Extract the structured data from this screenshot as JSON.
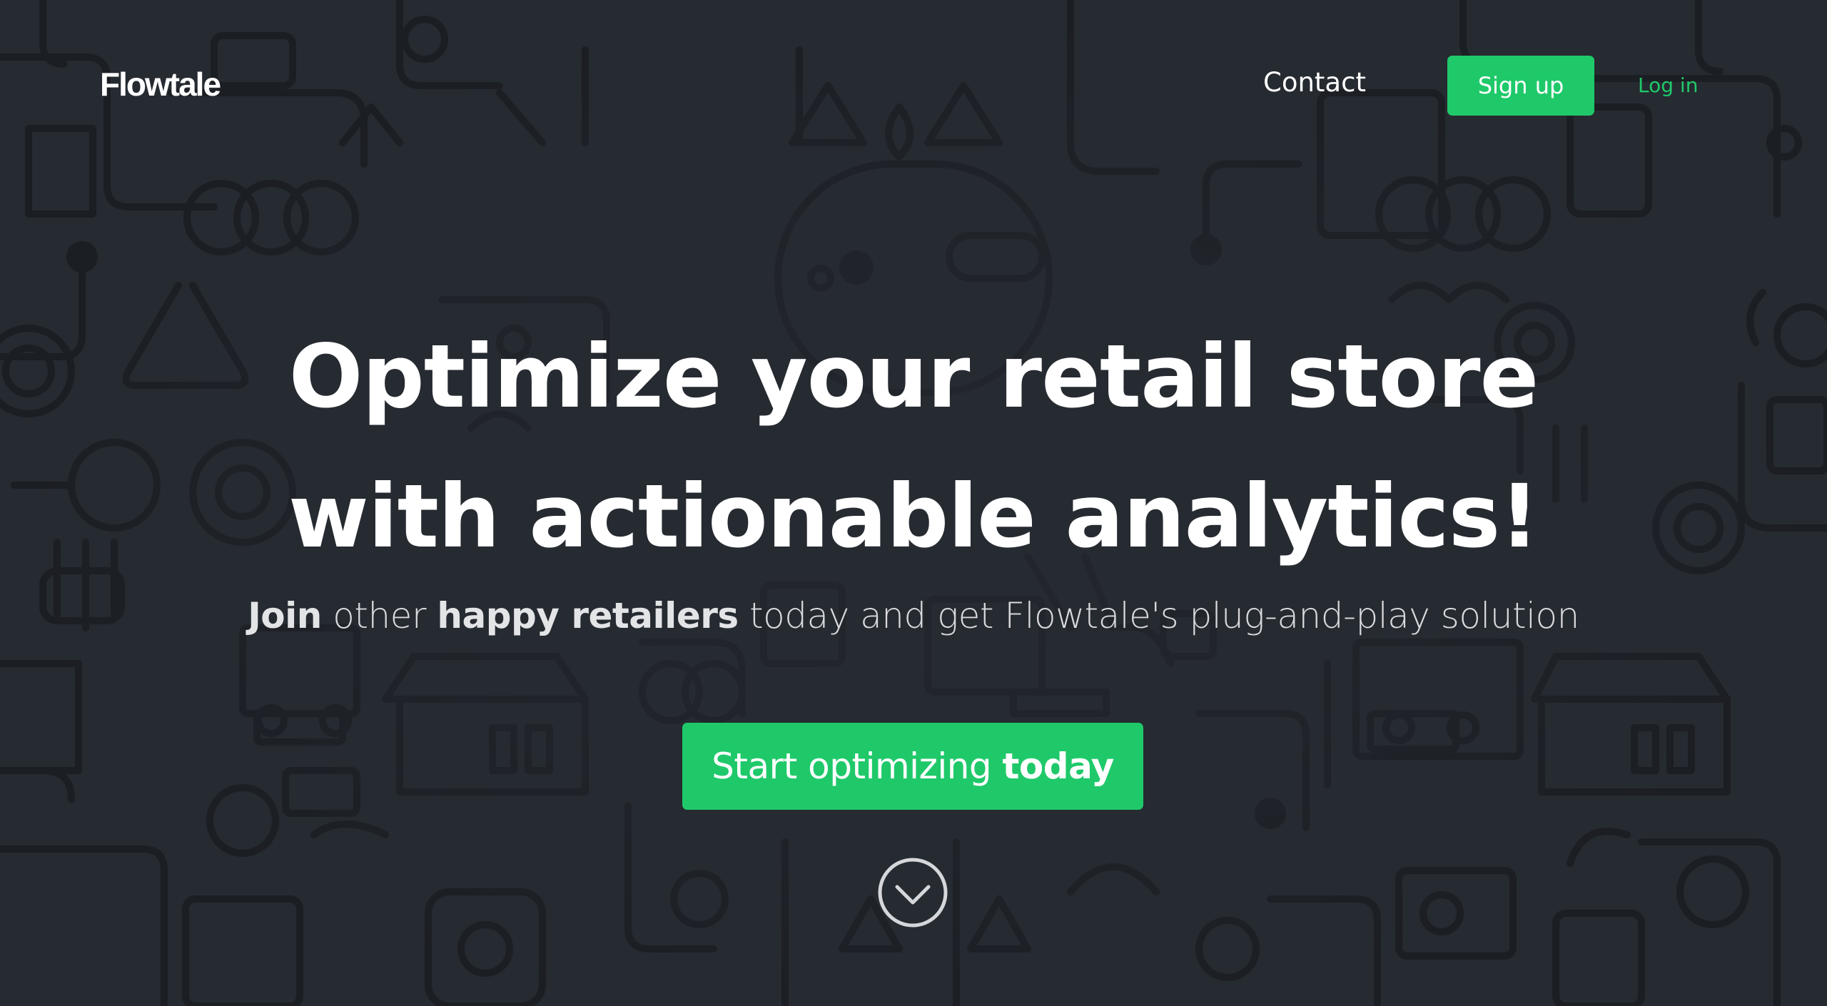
{
  "header": {
    "logo": "Flowtale",
    "nav_contact": "Contact",
    "signup_label": "Sign up",
    "login_label": "Log in"
  },
  "hero": {
    "headline_line1": "Optimize your retail store",
    "headline_line2": "with actionable analytics!",
    "subline": {
      "part1": "Join",
      "part2": " other ",
      "part3": "happy retailers",
      "part4": " today and get Flowtale's plug-and-play solution"
    },
    "cta": {
      "label_regular": "Start optimizing ",
      "label_bold": "today"
    },
    "scroll_icon": "chevron-down-circle-icon"
  },
  "colors": {
    "background": "#262a31",
    "pattern": "#1b1e23",
    "accent": "#1fc96a",
    "text": "#ffffff"
  }
}
